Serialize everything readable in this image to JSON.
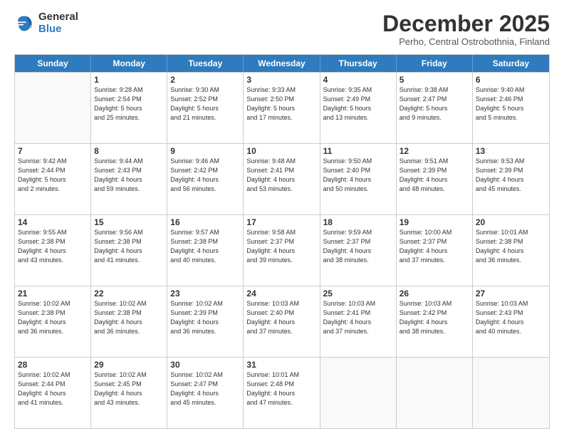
{
  "logo": {
    "general": "General",
    "blue": "Blue"
  },
  "title": "December 2025",
  "subtitle": "Perho, Central Ostrobothnia, Finland",
  "header_days": [
    "Sunday",
    "Monday",
    "Tuesday",
    "Wednesday",
    "Thursday",
    "Friday",
    "Saturday"
  ],
  "weeks": [
    [
      {
        "day": "",
        "info": ""
      },
      {
        "day": "1",
        "info": "Sunrise: 9:28 AM\nSunset: 2:54 PM\nDaylight: 5 hours\nand 25 minutes."
      },
      {
        "day": "2",
        "info": "Sunrise: 9:30 AM\nSunset: 2:52 PM\nDaylight: 5 hours\nand 21 minutes."
      },
      {
        "day": "3",
        "info": "Sunrise: 9:33 AM\nSunset: 2:50 PM\nDaylight: 5 hours\nand 17 minutes."
      },
      {
        "day": "4",
        "info": "Sunrise: 9:35 AM\nSunset: 2:49 PM\nDaylight: 5 hours\nand 13 minutes."
      },
      {
        "day": "5",
        "info": "Sunrise: 9:38 AM\nSunset: 2:47 PM\nDaylight: 5 hours\nand 9 minutes."
      },
      {
        "day": "6",
        "info": "Sunrise: 9:40 AM\nSunset: 2:46 PM\nDaylight: 5 hours\nand 5 minutes."
      }
    ],
    [
      {
        "day": "7",
        "info": "Sunrise: 9:42 AM\nSunset: 2:44 PM\nDaylight: 5 hours\nand 2 minutes."
      },
      {
        "day": "8",
        "info": "Sunrise: 9:44 AM\nSunset: 2:43 PM\nDaylight: 4 hours\nand 59 minutes."
      },
      {
        "day": "9",
        "info": "Sunrise: 9:46 AM\nSunset: 2:42 PM\nDaylight: 4 hours\nand 56 minutes."
      },
      {
        "day": "10",
        "info": "Sunrise: 9:48 AM\nSunset: 2:41 PM\nDaylight: 4 hours\nand 53 minutes."
      },
      {
        "day": "11",
        "info": "Sunrise: 9:50 AM\nSunset: 2:40 PM\nDaylight: 4 hours\nand 50 minutes."
      },
      {
        "day": "12",
        "info": "Sunrise: 9:51 AM\nSunset: 2:39 PM\nDaylight: 4 hours\nand 48 minutes."
      },
      {
        "day": "13",
        "info": "Sunrise: 9:53 AM\nSunset: 2:39 PM\nDaylight: 4 hours\nand 45 minutes."
      }
    ],
    [
      {
        "day": "14",
        "info": "Sunrise: 9:55 AM\nSunset: 2:38 PM\nDaylight: 4 hours\nand 43 minutes."
      },
      {
        "day": "15",
        "info": "Sunrise: 9:56 AM\nSunset: 2:38 PM\nDaylight: 4 hours\nand 41 minutes."
      },
      {
        "day": "16",
        "info": "Sunrise: 9:57 AM\nSunset: 2:38 PM\nDaylight: 4 hours\nand 40 minutes."
      },
      {
        "day": "17",
        "info": "Sunrise: 9:58 AM\nSunset: 2:37 PM\nDaylight: 4 hours\nand 39 minutes."
      },
      {
        "day": "18",
        "info": "Sunrise: 9:59 AM\nSunset: 2:37 PM\nDaylight: 4 hours\nand 38 minutes."
      },
      {
        "day": "19",
        "info": "Sunrise: 10:00 AM\nSunset: 2:37 PM\nDaylight: 4 hours\nand 37 minutes."
      },
      {
        "day": "20",
        "info": "Sunrise: 10:01 AM\nSunset: 2:38 PM\nDaylight: 4 hours\nand 36 minutes."
      }
    ],
    [
      {
        "day": "21",
        "info": "Sunrise: 10:02 AM\nSunset: 2:38 PM\nDaylight: 4 hours\nand 36 minutes."
      },
      {
        "day": "22",
        "info": "Sunrise: 10:02 AM\nSunset: 2:38 PM\nDaylight: 4 hours\nand 36 minutes."
      },
      {
        "day": "23",
        "info": "Sunrise: 10:02 AM\nSunset: 2:39 PM\nDaylight: 4 hours\nand 36 minutes."
      },
      {
        "day": "24",
        "info": "Sunrise: 10:03 AM\nSunset: 2:40 PM\nDaylight: 4 hours\nand 37 minutes."
      },
      {
        "day": "25",
        "info": "Sunrise: 10:03 AM\nSunset: 2:41 PM\nDaylight: 4 hours\nand 37 minutes."
      },
      {
        "day": "26",
        "info": "Sunrise: 10:03 AM\nSunset: 2:42 PM\nDaylight: 4 hours\nand 38 minutes."
      },
      {
        "day": "27",
        "info": "Sunrise: 10:03 AM\nSunset: 2:43 PM\nDaylight: 4 hours\nand 40 minutes."
      }
    ],
    [
      {
        "day": "28",
        "info": "Sunrise: 10:02 AM\nSunset: 2:44 PM\nDaylight: 4 hours\nand 41 minutes."
      },
      {
        "day": "29",
        "info": "Sunrise: 10:02 AM\nSunset: 2:45 PM\nDaylight: 4 hours\nand 43 minutes."
      },
      {
        "day": "30",
        "info": "Sunrise: 10:02 AM\nSunset: 2:47 PM\nDaylight: 4 hours\nand 45 minutes."
      },
      {
        "day": "31",
        "info": "Sunrise: 10:01 AM\nSunset: 2:48 PM\nDaylight: 4 hours\nand 47 minutes."
      },
      {
        "day": "",
        "info": ""
      },
      {
        "day": "",
        "info": ""
      },
      {
        "day": "",
        "info": ""
      }
    ]
  ]
}
